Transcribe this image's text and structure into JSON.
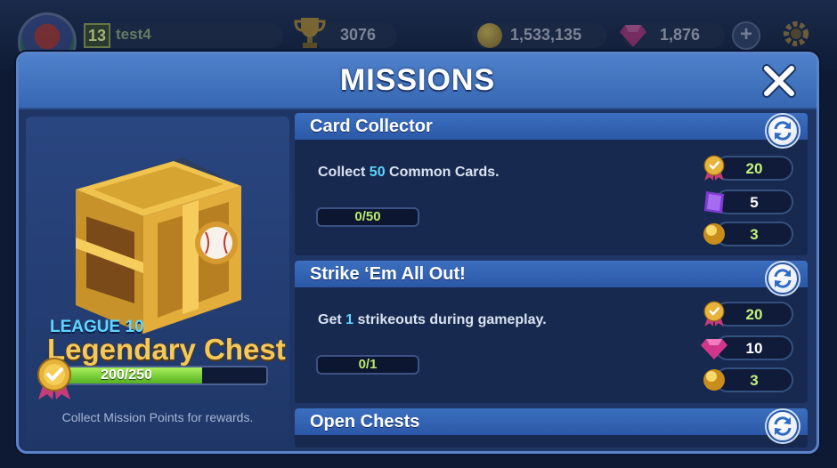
{
  "topbar": {
    "level": "13",
    "username": "test4",
    "trophies": "3076",
    "coins": "1,533,135",
    "gems": "1,876",
    "plus_label": "+"
  },
  "modal": {
    "title": "MISSIONS",
    "close_label": "✕"
  },
  "chest": {
    "league": "LEAGUE 10",
    "name": "Legendary Chest",
    "progress_text": "200/250",
    "progress_fraction": 0.8,
    "footer": "Collect Mission Points for rewards."
  },
  "missions": [
    {
      "title": "Card Collector",
      "desc_pre": "Collect ",
      "desc_num": "50",
      "desc_post": " Common Cards.",
      "progress": "0/50",
      "rewards": [
        {
          "icon": "mission-point-medal-icon",
          "value": "20"
        },
        {
          "icon": "purple-card-pack-icon",
          "value": "5"
        },
        {
          "icon": "gold-coin-icon",
          "value": "3"
        }
      ]
    },
    {
      "title": "Strike ‘Em All Out!",
      "desc_pre": "Get ",
      "desc_num": "1",
      "desc_post": " strikeouts during gameplay.",
      "progress": "0/1",
      "rewards": [
        {
          "icon": "mission-point-medal-icon",
          "value": "20"
        },
        {
          "icon": "pink-gem-icon",
          "value": "10"
        },
        {
          "icon": "gold-coin-icon",
          "value": "3"
        }
      ]
    },
    {
      "title": "Open Chests"
    }
  ],
  "colors": {
    "accent_blue": "#3c6fc0",
    "highlight_cyan": "#5fd3ff",
    "gold_title": "#f4c95a",
    "progress_green": "#56b222"
  }
}
